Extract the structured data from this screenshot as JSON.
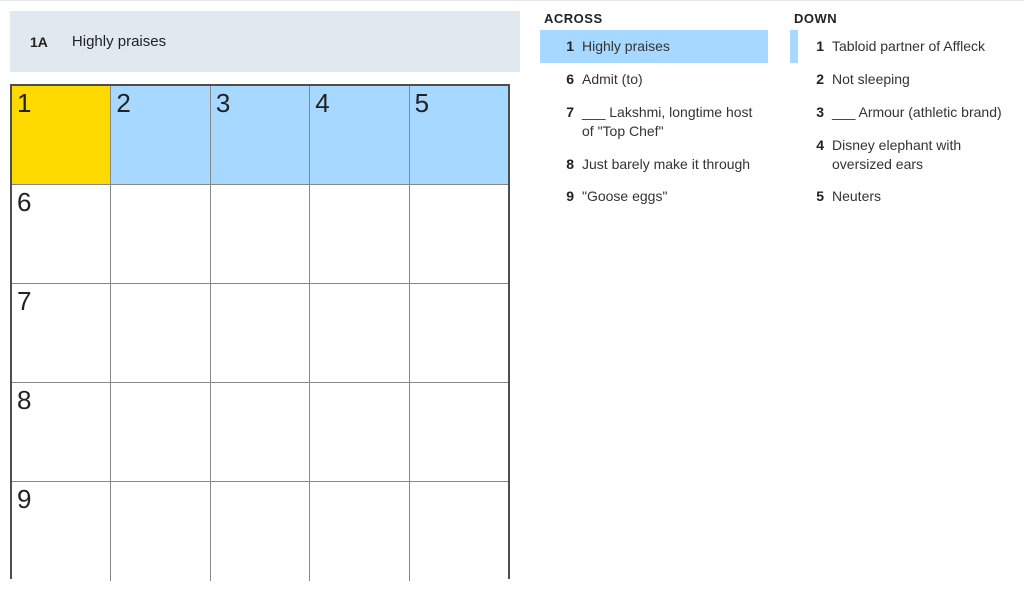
{
  "current_clue": {
    "label": "1A",
    "text": "Highly praises"
  },
  "grid": {
    "rows": 5,
    "cols": 5,
    "cells": [
      [
        {
          "n": "1",
          "state": "cur"
        },
        {
          "n": "2",
          "state": "hl"
        },
        {
          "n": "3",
          "state": "hl"
        },
        {
          "n": "4",
          "state": "hl"
        },
        {
          "n": "5",
          "state": "hl"
        }
      ],
      [
        {
          "n": "6",
          "state": ""
        },
        {
          "n": "",
          "state": ""
        },
        {
          "n": "",
          "state": ""
        },
        {
          "n": "",
          "state": ""
        },
        {
          "n": "",
          "state": ""
        }
      ],
      [
        {
          "n": "7",
          "state": ""
        },
        {
          "n": "",
          "state": ""
        },
        {
          "n": "",
          "state": ""
        },
        {
          "n": "",
          "state": ""
        },
        {
          "n": "",
          "state": ""
        }
      ],
      [
        {
          "n": "8",
          "state": ""
        },
        {
          "n": "",
          "state": ""
        },
        {
          "n": "",
          "state": ""
        },
        {
          "n": "",
          "state": ""
        },
        {
          "n": "",
          "state": ""
        }
      ],
      [
        {
          "n": "9",
          "state": ""
        },
        {
          "n": "",
          "state": ""
        },
        {
          "n": "",
          "state": ""
        },
        {
          "n": "",
          "state": ""
        },
        {
          "n": "",
          "state": ""
        }
      ]
    ]
  },
  "across": {
    "heading": "ACROSS",
    "clues": [
      {
        "num": "1",
        "text": "Highly praises",
        "state": "sel"
      },
      {
        "num": "6",
        "text": "Admit (to)",
        "state": ""
      },
      {
        "num": "7",
        "text": "___ Lakshmi, longtime host of \"Top Chef\"",
        "state": ""
      },
      {
        "num": "8",
        "text": "Just barely make it through",
        "state": ""
      },
      {
        "num": "9",
        "text": "\"Goose eggs\"",
        "state": ""
      }
    ]
  },
  "down": {
    "heading": "DOWN",
    "clues": [
      {
        "num": "1",
        "text": "Tabloid partner of Affleck",
        "state": "cross"
      },
      {
        "num": "2",
        "text": "Not sleeping",
        "state": ""
      },
      {
        "num": "3",
        "text": "___ Armour (athletic brand)",
        "state": ""
      },
      {
        "num": "4",
        "text": "Disney elephant with oversized ears",
        "state": ""
      },
      {
        "num": "5",
        "text": "Neuters",
        "state": ""
      }
    ]
  }
}
